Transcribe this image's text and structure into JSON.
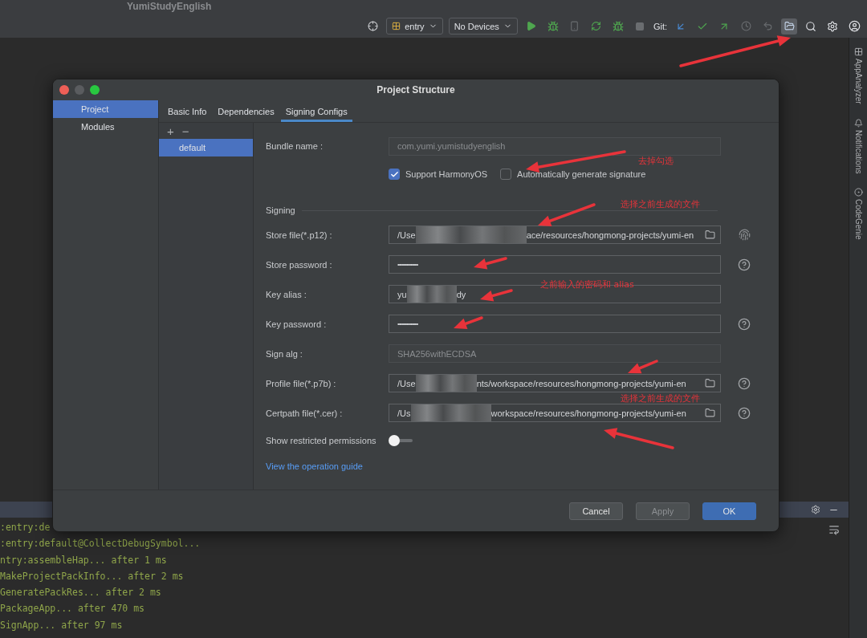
{
  "app_title": "YumiStudyEnglish",
  "toolbar": {
    "run_config": "entry",
    "device": "No Devices",
    "git_label": "Git:"
  },
  "right_strip": [
    {
      "label": "AppAnalyzer"
    },
    {
      "label": "Notifications"
    },
    {
      "label": "CodeGenie"
    }
  ],
  "dialog": {
    "title": "Project Structure",
    "sidebar": [
      {
        "label": "Project",
        "selected": true
      },
      {
        "label": "Modules",
        "selected": false
      }
    ],
    "tabs": [
      {
        "label": "Basic Info",
        "selected": false
      },
      {
        "label": "Dependencies",
        "selected": false
      },
      {
        "label": "Signing Configs",
        "selected": true
      }
    ],
    "configs": {
      "add": "+",
      "remove": "−",
      "items": [
        {
          "label": "default",
          "selected": true
        }
      ]
    },
    "bundle": {
      "label": "Bundle name :",
      "value": "com.yumi.yumistudyenglish"
    },
    "checkboxes": [
      {
        "label": "Support HarmonyOS",
        "checked": true
      },
      {
        "label": "Automatically generate signature",
        "checked": false
      }
    ],
    "section": "Signing",
    "fields": [
      {
        "kind": "file",
        "label": "Store file(*.p12) :",
        "value_start": "/Use",
        "value_end": "ace/resources/hongmong-projects/yumi-en",
        "fingerprint_button": true
      },
      {
        "kind": "password",
        "label": "Store password :",
        "value": "••••••••••••••",
        "help_button": true
      },
      {
        "kind": "text",
        "label": "Key alias :",
        "value_start": "yu",
        "value_end": "dy",
        "help_button": false
      },
      {
        "kind": "password",
        "label": "Key password :",
        "value": "••••••••••••••",
        "help_button": true
      },
      {
        "kind": "readonly",
        "label": "Sign alg :",
        "value": "SHA256withECDSA",
        "help_button": false
      },
      {
        "kind": "file",
        "label": "Profile file(*.p7b) :",
        "value_start": "/Use",
        "value_end": "nts/workspace/resources/hongmong-projects/yumi-en",
        "help_button": true
      },
      {
        "kind": "file",
        "label": "Certpath file(*.cer) :",
        "value_start": "/Us",
        "value_end": "workspace/resources/hongmong-projects/yumi-en",
        "help_button": true
      }
    ],
    "toggle": {
      "label": "Show restricted permissions",
      "on": false
    },
    "link": "View the operation guide",
    "buttons": [
      {
        "label": "Cancel",
        "kind": "default"
      },
      {
        "label": "Apply",
        "kind": "disabled"
      },
      {
        "label": "OK",
        "kind": "primary"
      }
    ]
  },
  "console": {
    "lines": [
      ":entry:de",
      ":entry:default@CollectDebugSymbol...",
      "ntry:assembleHap... after 1 ms",
      "MakeProjectPackInfo... after 2 ms",
      "GeneratePackRes... after 2 ms",
      "PackageApp... after 470 ms",
      "SignApp... after 97 ms"
    ]
  },
  "notes": [
    {
      "text": "去掉勾选"
    },
    {
      "text": "选择之前生成的文件"
    },
    {
      "text": "之前输入的密码和 alias"
    },
    {
      "text": "选择之前生成的文件"
    }
  ]
}
